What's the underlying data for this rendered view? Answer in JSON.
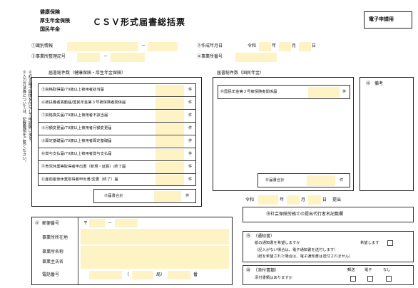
{
  "header": {
    "schemes": [
      "健康保険",
      "厚生年金保険",
      "国民年金"
    ],
    "title": "ＣＳＶ形式届書総括票",
    "badge": "電子申請用"
  },
  "top": {
    "id_label": "①識別情報",
    "id_dash": "－",
    "employer_code_label": "③事業所整理記号",
    "employer_code_dash": "－",
    "date_label": "②作成年月日",
    "era": "令和",
    "year_unit": "年",
    "month_unit": "月",
    "day_unit": "日",
    "office_no_label": "④事業所番号"
  },
  "side_note": [
    "※入力方法等については、記載要領をご覧ください。",
    "※必ず電子媒体を付与して申請願います。"
  ],
  "left_section": {
    "title": "届書総件数（健康保険・厚生年金保険）",
    "unit": "件",
    "rows": [
      "⑤資格取得届/70歳以上被用者該当届",
      "⑥被扶養者異動届/国民年金第３号被保険者関係届",
      "⑦資格喪失届/70歳以上被用者不該当届",
      "⑧月額変更届/70歳以上被用者月額変更届",
      "⑨算定基礎届/70歳以上被用者算定基礎届",
      "⑩賞与支払届/70歳以上被用者賞与支払届",
      "⑪育児休業等取得者申出書（新規・延長）/終了届",
      "⑫産前産後休業取得者申出書/変更（終了）届"
    ],
    "total": "⑬届書合計"
  },
  "middle_section": {
    "title": "届書総件数（国民年金）",
    "row": "⑭国民年金第３号被保険者関係届",
    "total": "⑮届書合計",
    "unit": "件"
  },
  "remarks": {
    "label": "⑯　備考"
  },
  "submit_date": {
    "era": "令和",
    "year": "年",
    "month": "月",
    "day": "日",
    "submit": "提出"
  },
  "proxy": {
    "label": "⑱社会保険労務士の提出代行者名記載欄"
  },
  "applicant": {
    "num": "⑰",
    "postal_label": "郵便番号",
    "postal_mark": "〒",
    "postal_dash": "－",
    "address_label": "事業所所在地",
    "name_label": "事業所名称",
    "owner_label": "事業主氏名",
    "phone_label": "電話番号",
    "phone_open": "（",
    "phone_local": "局）",
    "phone_ban": "番"
  },
  "notice": {
    "num": "⑲",
    "label": "（通知書）",
    "line1": "紙の通知書を希望しますか",
    "wish": "希望します",
    "note1": "（記入がない場合は、電子通知書を送付します）",
    "note2": "（紙を希望された場合は、電子通知書は送付されません）"
  },
  "attachment": {
    "num": "⑳",
    "label": "（添付書類）",
    "line1": "添付書類はありますか",
    "opts": [
      "郵送",
      "電子",
      "なし"
    ]
  }
}
